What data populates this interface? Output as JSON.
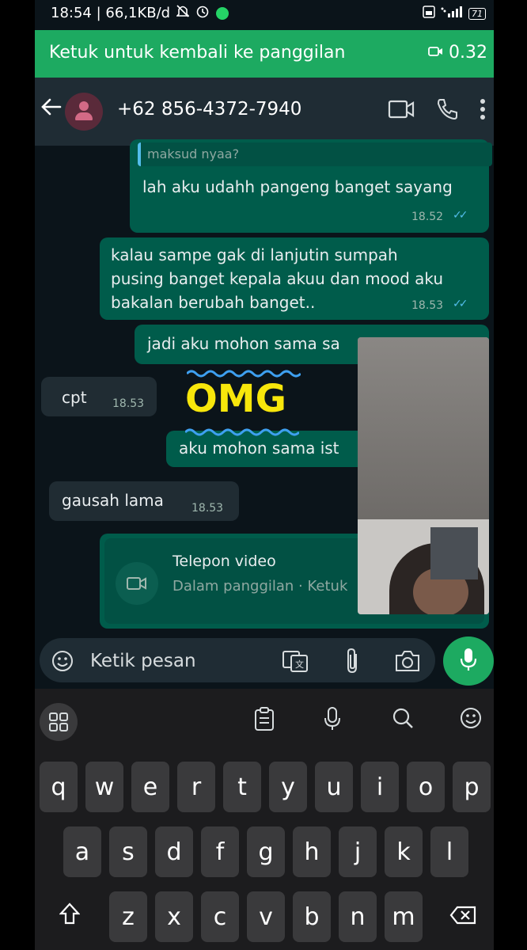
{
  "status": {
    "time_net": "18:54 | 66,1KB/d",
    "battery": "71"
  },
  "call_banner": {
    "label": "Ketuk untuk kembali ke panggilan",
    "timer": "0.32"
  },
  "header": {
    "contact": "+62 856-4372-7940"
  },
  "messages": [
    {
      "text": "maksud nyaa?",
      "type": "quote"
    },
    {
      "text": "lah aku udahh pangeng banget sayang",
      "time": "18.52",
      "dir": "out"
    },
    {
      "text": "kalau sampe gak di lanjutin sumpah",
      "dir": "out"
    },
    {
      "text": "pusing banget kepala akuu dan mood aku"
    },
    {
      "text": "bakalan berubah banget..",
      "time": "18.53"
    },
    {
      "text": "jadi aku mohon sama sa",
      "dir": "out"
    },
    {
      "text": "cpt",
      "time": "18.53",
      "dir": "in"
    },
    {
      "text": "aku mohon sama ist",
      "dir": "out"
    },
    {
      "text": "gausah lama",
      "time": "18.53",
      "dir": "in"
    }
  ],
  "video_call": {
    "title": "Telepon video",
    "subtitle": "Dalam panggilan · Ketuk"
  },
  "overlay": {
    "omg": "OMG"
  },
  "composer": {
    "placeholder": "Ketik pesan"
  },
  "keyboard": {
    "row1": [
      "q",
      "w",
      "e",
      "r",
      "t",
      "y",
      "u",
      "i",
      "o",
      "p"
    ],
    "row2": [
      "a",
      "s",
      "d",
      "f",
      "g",
      "h",
      "j",
      "k",
      "l"
    ],
    "row3": [
      "z",
      "x",
      "c",
      "v",
      "b",
      "n",
      "m"
    ]
  }
}
